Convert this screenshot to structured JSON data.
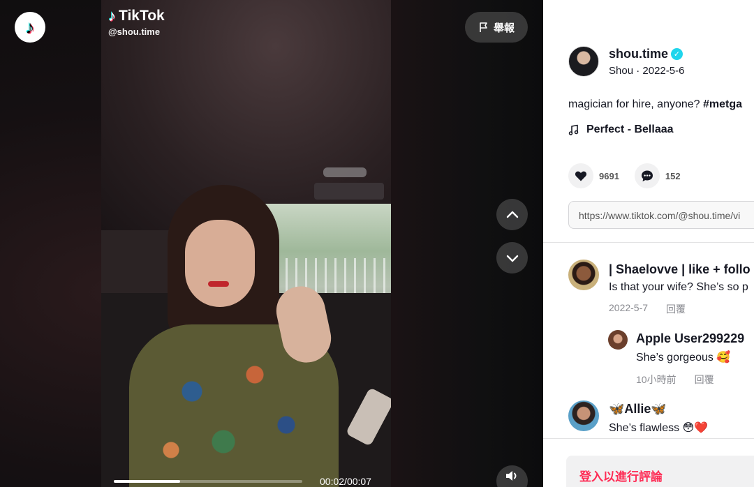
{
  "watermark": {
    "brand": "TikTok",
    "username": "@shou.time"
  },
  "header": {
    "report_label": "舉報"
  },
  "player": {
    "current_time": "00:02",
    "duration": "00:07",
    "progress": 0.35
  },
  "author": {
    "username": "shou.time",
    "display_name": "Shou",
    "date": "2022-5-6",
    "verified": true
  },
  "video": {
    "caption_text": "magician for hire, anyone? ",
    "caption_tag": "#metga",
    "music": "Perfect - Bellaaa",
    "likes": "9691",
    "comments_count": "152",
    "link": "https://www.tiktok.com/@shou.time/vi"
  },
  "comments": [
    {
      "name": "| Shaelovve | like + follo",
      "text": "Is that your wife? She’s so p",
      "date": "2022-5-7",
      "reply_label": "回覆"
    },
    {
      "name": "Apple User299229",
      "text": "She’s gorgeous 🥰",
      "date": "10小時前",
      "reply_label": "回覆"
    },
    {
      "name": "🦋Allie🦋",
      "text": "She’s flawless 😳❤️"
    }
  ],
  "footer": {
    "login_prompt": "登入以進行評論"
  },
  "icons": {
    "logo": "tiktok-logo-icon",
    "report": "flag-icon",
    "up": "chevron-up-icon",
    "down": "chevron-down-icon",
    "volume": "volume-icon",
    "verified": "verified-badge-icon",
    "music": "music-note-icon",
    "like": "heart-icon",
    "comment": "comment-bubble-icon"
  },
  "colors": {
    "accent": "#fe2c55",
    "verified": "#20d5ec",
    "panel_bg": "#ffffff"
  }
}
